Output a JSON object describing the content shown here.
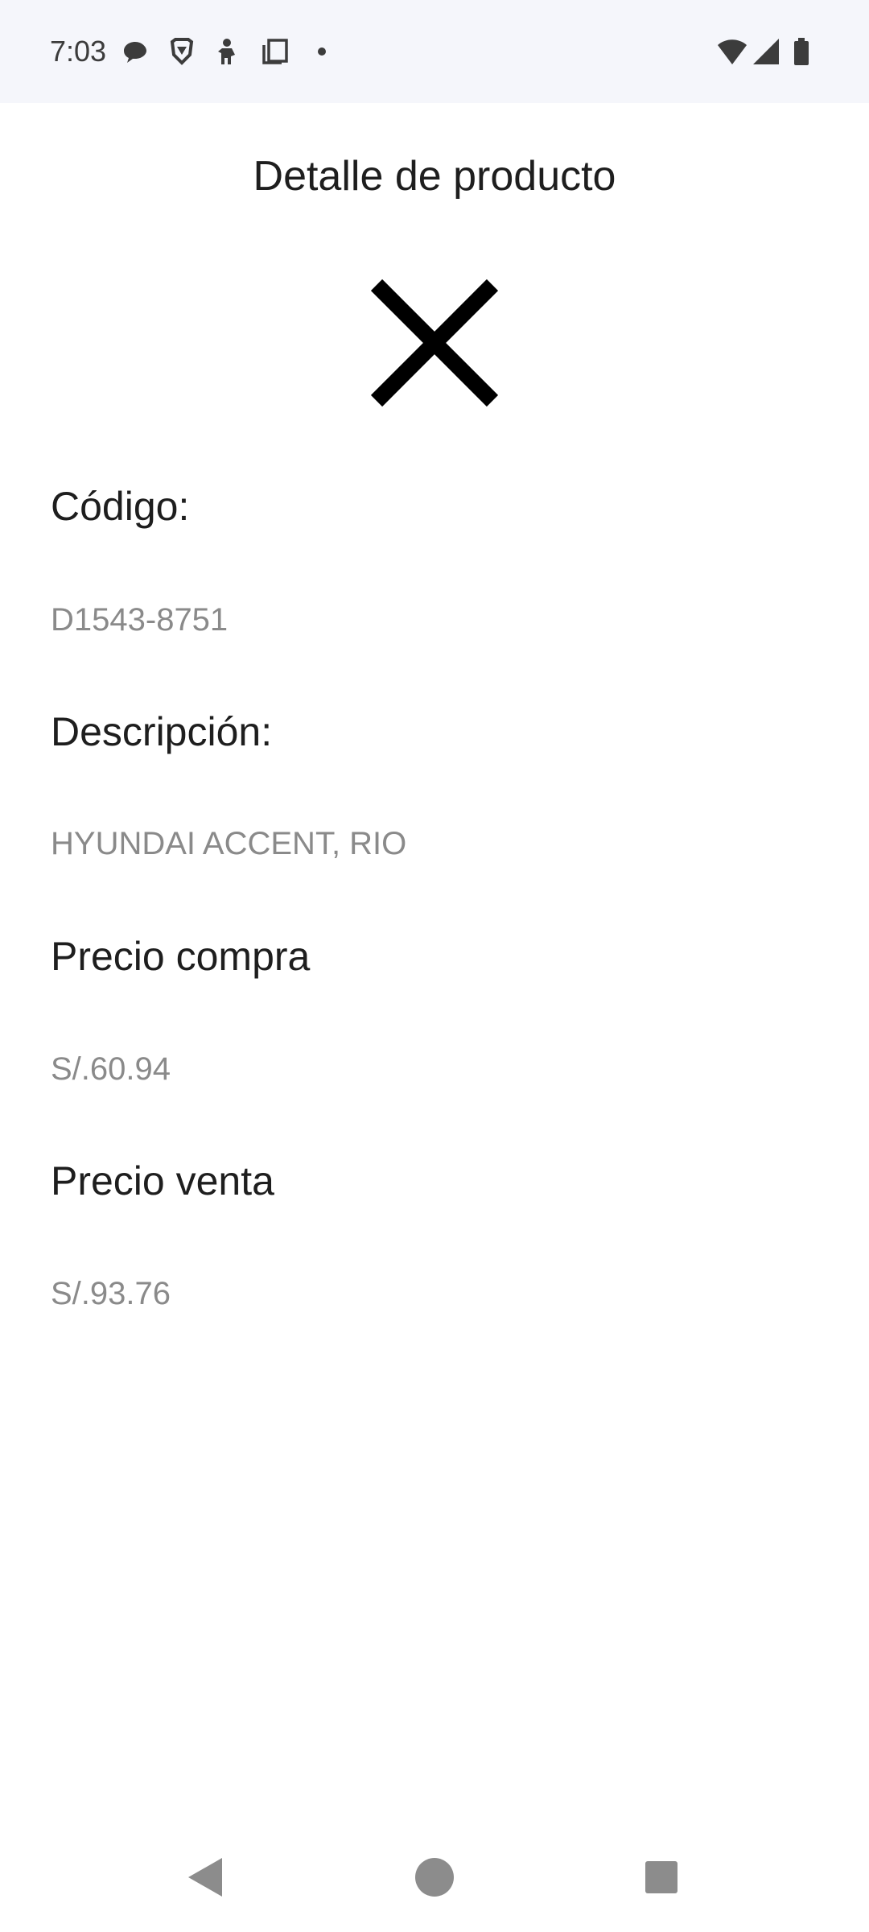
{
  "status_bar": {
    "time": "7:03",
    "icons_left": [
      "chat-bubble-icon",
      "brave-lion-icon",
      "figure-icon",
      "copy-icon",
      "dot-icon"
    ],
    "icons_right": [
      "wifi-icon",
      "cellular-signal-icon",
      "battery-icon"
    ]
  },
  "header": {
    "title": "Detalle de producto"
  },
  "close_icon": "close-icon",
  "fields": {
    "codigo": {
      "label": "Código:",
      "value": "D1543-8751"
    },
    "descripcion": {
      "label": "Descripción:",
      "value": "HYUNDAI ACCENT, RIO"
    },
    "precio_compra": {
      "label": "Precio compra",
      "value": "S/.60.94"
    },
    "precio_venta": {
      "label": "Precio venta",
      "value": "S/.93.76"
    }
  },
  "nav_bar": {
    "buttons": [
      "back-icon",
      "home-icon",
      "recents-icon"
    ]
  },
  "colors": {
    "status_bar_bg": "#f5f6fb",
    "label_text": "#1e1e1e",
    "value_text": "#8a8a8a",
    "nav_icon": "#8c8c8c"
  }
}
